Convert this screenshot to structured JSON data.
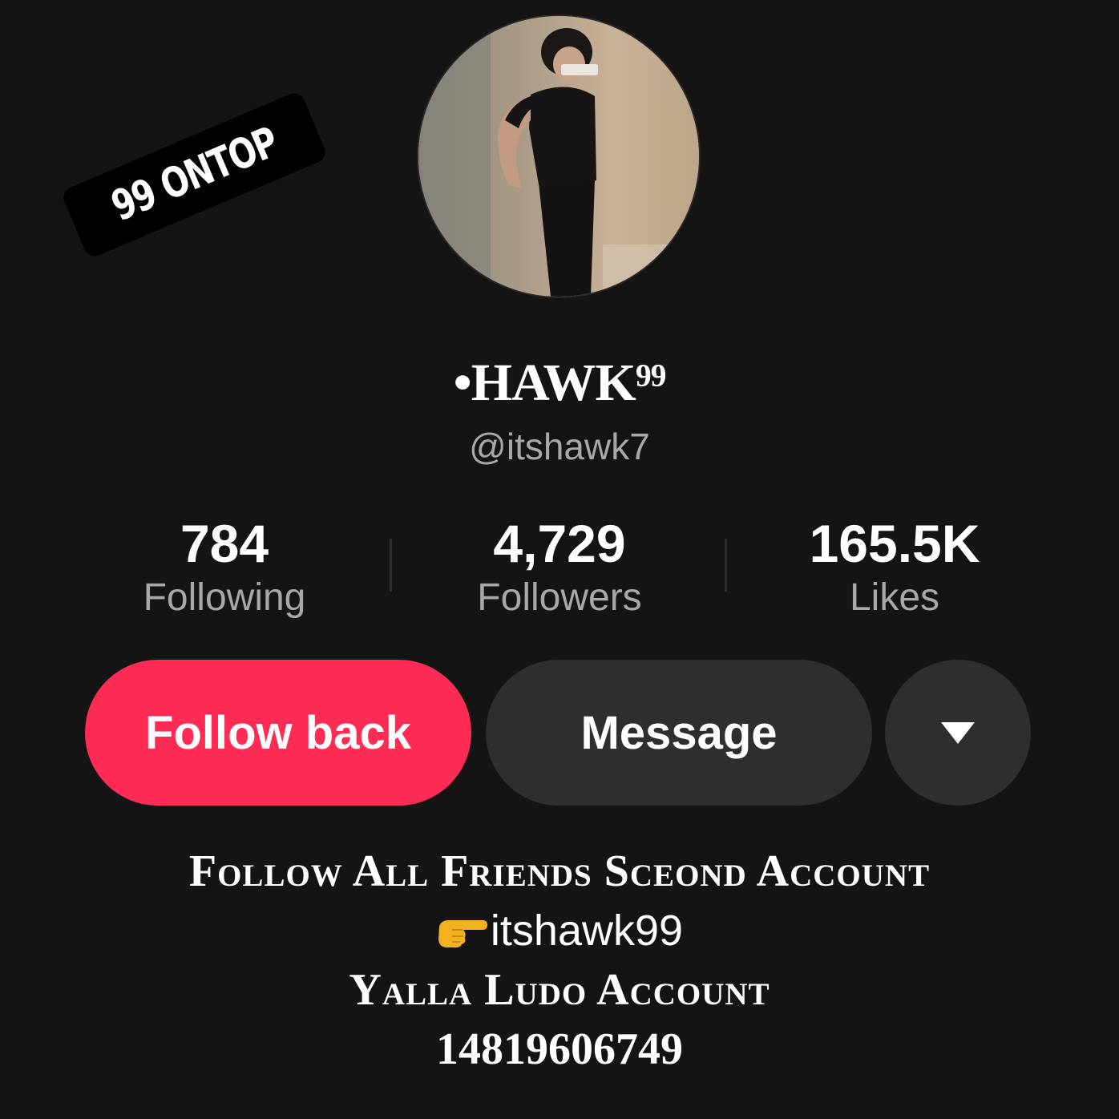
{
  "sticker": {
    "text": "99 ONTOP"
  },
  "profile": {
    "display_name": "•HAWK⁹⁹",
    "username": "@itshawk7",
    "avatar": "profile-photo"
  },
  "stats": {
    "following": {
      "value": "784",
      "label": "Following"
    },
    "followers": {
      "value": "4,729",
      "label": "Followers"
    },
    "likes": {
      "value": "165.5K",
      "label": "Likes"
    }
  },
  "actions": {
    "follow_back": "Follow back",
    "message": "Message",
    "more_icon": "caret-down-icon"
  },
  "bio": {
    "line1": "Follow All Friends Sceond Account",
    "handle_icon": "pointing-hand-emoji",
    "handle": "itshawk99",
    "line3": "Yalla Ludo Account",
    "number": "14819606749"
  },
  "colors": {
    "background": "#151415",
    "accent": "#fe2c55",
    "secondary_button": "#2f2e2f",
    "muted_text": "#a8a8a8"
  }
}
